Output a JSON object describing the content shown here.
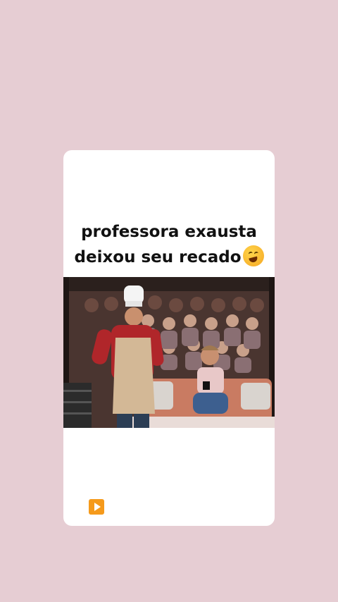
{
  "caption": {
    "line1": "professora exausta",
    "line2": "deixou seu recado"
  },
  "icons": {
    "caption_emoji": "rolling-on-floor-laughing-emoji",
    "play_badge": "play-button-icon"
  },
  "colors": {
    "background": "#e6cdd3",
    "card": "#ffffff",
    "play_badge": "#f59a1b"
  }
}
